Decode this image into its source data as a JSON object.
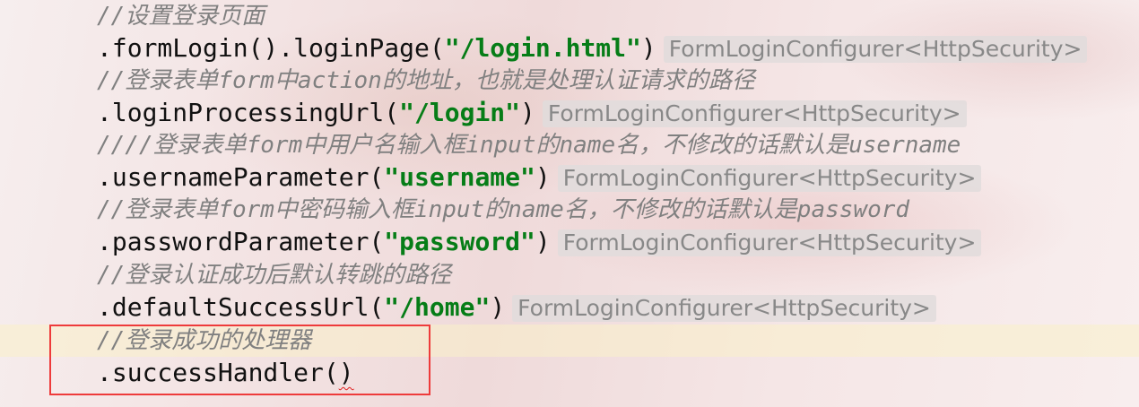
{
  "code_lines": [
    {
      "type": "comment",
      "text": "//设置登录页面"
    },
    {
      "type": "code",
      "prefix": ".formLogin().loginPage(",
      "string": "\"/login.html\"",
      "suffix": ")",
      "hint": "FormLoginConfigurer<HttpSecurity>"
    },
    {
      "type": "comment",
      "text": "//登录表单form中action的地址，也就是处理认证请求的路径"
    },
    {
      "type": "code",
      "prefix": ".loginProcessingUrl(",
      "string": "\"/login\"",
      "suffix": ")",
      "hint": "FormLoginConfigurer<HttpSecurity>"
    },
    {
      "type": "comment",
      "text": "////登录表单form中用户名输入框input的name名，不修改的话默认是username"
    },
    {
      "type": "code",
      "prefix": ".usernameParameter(",
      "string": "\"username\"",
      "suffix": ")",
      "hint": "FormLoginConfigurer<HttpSecurity>"
    },
    {
      "type": "comment",
      "text": "//登录表单form中密码输入框input的name名，不修改的话默认是password"
    },
    {
      "type": "code",
      "prefix": ".passwordParameter(",
      "string": "\"password\"",
      "suffix": ")",
      "hint": "FormLoginConfigurer<HttpSecurity>"
    },
    {
      "type": "comment",
      "text": "//登录认证成功后默认转跳的路径"
    },
    {
      "type": "code",
      "prefix": ".defaultSuccessUrl(",
      "string": "\"/home\"",
      "suffix": ")",
      "hint": "FormLoginConfigurer<HttpSecurity>"
    },
    {
      "type": "comment",
      "text": "//登录成功的处理器"
    },
    {
      "type": "code",
      "prefix": ".successHandler(",
      "error": ")"
    }
  ],
  "colors": {
    "string": "#067d17",
    "comment": "#808080",
    "highlight_box": "#ee3b3b",
    "error_squiggle": "#e02020"
  }
}
